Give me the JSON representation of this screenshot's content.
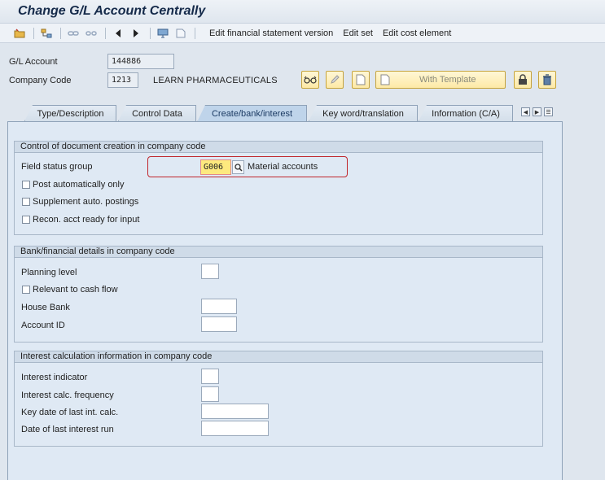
{
  "window": {
    "title": "Change G/L Account Centrally"
  },
  "toolbar": {
    "icons": [
      "folder-icon",
      "hierarchy-icon",
      "link-icon",
      "unlink-icon",
      "arrow-left-icon",
      "arrow-right-icon",
      "display-icon",
      "page-icon"
    ],
    "edit_financial_statement": "Edit financial statement version",
    "edit_set": "Edit set",
    "edit_cost_element": "Edit cost element"
  },
  "header": {
    "gl_account_label": "G/L Account",
    "gl_account_value": "144886",
    "company_code_label": "Company Code",
    "company_code_value": "1213",
    "company_name": "LEARN PHARMACEUTICALS",
    "with_template_label": "With Template"
  },
  "tabs": [
    {
      "label": "Type/Description",
      "active": false
    },
    {
      "label": "Control Data",
      "active": false
    },
    {
      "label": "Create/bank/interest",
      "active": true
    },
    {
      "label": "Key word/translation",
      "active": false
    },
    {
      "label": "Information (C/A)",
      "active": false
    }
  ],
  "doc_creation": {
    "title": "Control of document creation in company code",
    "field_status_group_label": "Field status group",
    "field_status_group_value": "G006",
    "field_status_group_desc": "Material accounts",
    "checkboxes": [
      {
        "label": "Post automatically only",
        "checked": false
      },
      {
        "label": "Supplement auto. postings",
        "checked": false
      },
      {
        "label": "Recon. acct ready for input",
        "checked": false
      }
    ]
  },
  "bank": {
    "title": "Bank/financial details in company code",
    "planning_level_label": "Planning level",
    "cash_flow_label": "Relevant to cash flow",
    "house_bank_label": "House Bank",
    "account_id_label": "Account ID"
  },
  "interest": {
    "title": "Interest calculation information in company code",
    "indicator_label": "Interest indicator",
    "frequency_label": "Interest calc. frequency",
    "key_date_label": "Key date of last int. calc.",
    "last_run_label": "Date of last interest run"
  }
}
